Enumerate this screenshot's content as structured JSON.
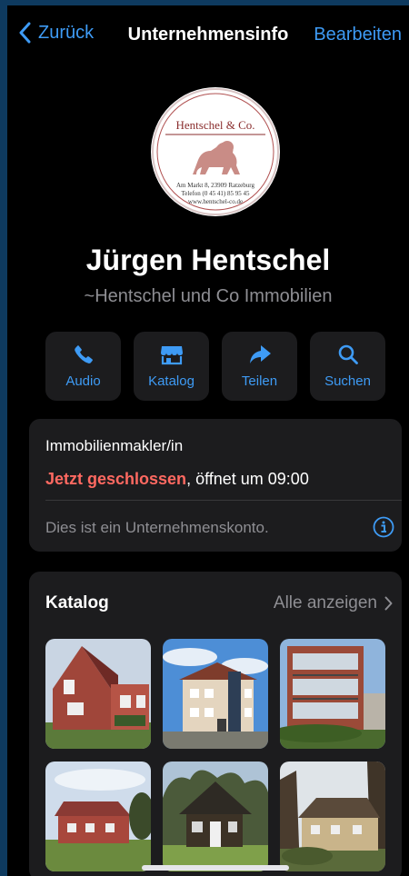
{
  "nav": {
    "back_label": "Zurück",
    "title": "Unternehmensinfo",
    "edit_label": "Bearbeiten"
  },
  "logo": {
    "brand": "Hentschel & Co.",
    "address": "Am Markt 8, 23909 Ratzeburg",
    "phone": "Telefon (0 45 41) 85 95 45",
    "web": "www.hentschel-co.de"
  },
  "profile": {
    "name": "Jürgen Hentschel",
    "subtitle": "~Hentschel und Co Immobilien"
  },
  "actions": [
    {
      "label": "Audio",
      "icon": "phone-icon"
    },
    {
      "label": "Katalog",
      "icon": "storefront-icon"
    },
    {
      "label": "Teilen",
      "icon": "share-arrow-icon"
    },
    {
      "label": "Suchen",
      "icon": "search-icon"
    }
  ],
  "info": {
    "role": "Immobilienmakler/in",
    "status_closed": "Jetzt geschlossen",
    "status_opens": ", öffnet um 09:00",
    "account_note": "Dies ist ein Unternehmenskonto.",
    "info_icon": "info-circle-icon"
  },
  "catalog": {
    "title": "Katalog",
    "show_all": "Alle anzeigen",
    "items": [
      {
        "name": "house-photo-1"
      },
      {
        "name": "house-photo-2"
      },
      {
        "name": "house-photo-3"
      },
      {
        "name": "house-photo-4"
      },
      {
        "name": "house-photo-5"
      },
      {
        "name": "house-photo-6"
      }
    ]
  },
  "colors": {
    "accent": "#3e9bf5",
    "closed": "#ff6961",
    "background": "#000000",
    "card": "#1c1c1e",
    "secondary_text": "#8e8e93"
  }
}
